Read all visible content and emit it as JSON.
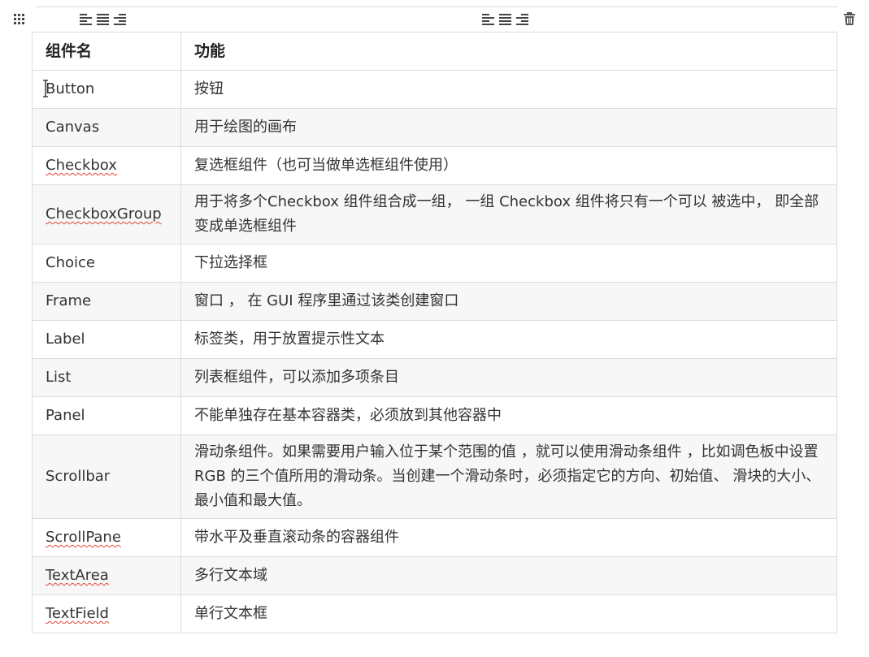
{
  "toolbar": {
    "left_icons": [
      "drag-grid-icon"
    ],
    "align_icons_left": [
      "align-left-icon",
      "align-center-icon",
      "align-right-icon"
    ],
    "align_icons_right": [
      "align-left-icon",
      "align-center-icon",
      "align-right-icon"
    ],
    "delete_icon": "trash-icon"
  },
  "table": {
    "headers": [
      "组件名",
      "功能"
    ],
    "rows": [
      {
        "name": "Button",
        "desc": "按钮",
        "spell": false
      },
      {
        "name": "Canvas",
        "desc": "用于绘图的画布",
        "spell": false
      },
      {
        "name": "Checkbox",
        "desc": "复选框组件（也可当做单选框组件使用）",
        "spell": true
      },
      {
        "name": "CheckboxGroup",
        "desc": "用于将多个Checkbox 组件组合成一组， 一组 Checkbox 组件将只有一个可以 被选中， 即全部变成单选框组件",
        "spell": true
      },
      {
        "name": "Choice",
        "desc": "下拉选择框",
        "spell": false
      },
      {
        "name": "Frame",
        "desc": "窗口 ， 在 GUI 程序里通过该类创建窗口",
        "spell": false
      },
      {
        "name": "Label",
        "desc": "标签类，用于放置提示性文本",
        "spell": false
      },
      {
        "name": "List",
        "desc": "列表框组件，可以添加多项条目",
        "spell": false
      },
      {
        "name": "Panel",
        "desc": "不能单独存在基本容器类，必须放到其他容器中",
        "spell": false
      },
      {
        "name": "Scrollbar",
        "desc": "滑动条组件。如果需要用户输入位于某个范围的值 ，就可以使用滑动条组件 ，比如调色板中设置 RGB 的三个值所用的滑动条。当创建一个滑动条时，必须指定它的方向、初始值、 滑块的大小、最小值和最大值。",
        "spell": false
      },
      {
        "name": "ScrollPane",
        "desc": "带水平及垂直滚动条的容器组件",
        "spell": true
      },
      {
        "name": "TextArea",
        "desc": "多行文本域",
        "spell": true
      },
      {
        "name": "TextField",
        "desc": "单行文本框",
        "spell": true
      }
    ]
  }
}
